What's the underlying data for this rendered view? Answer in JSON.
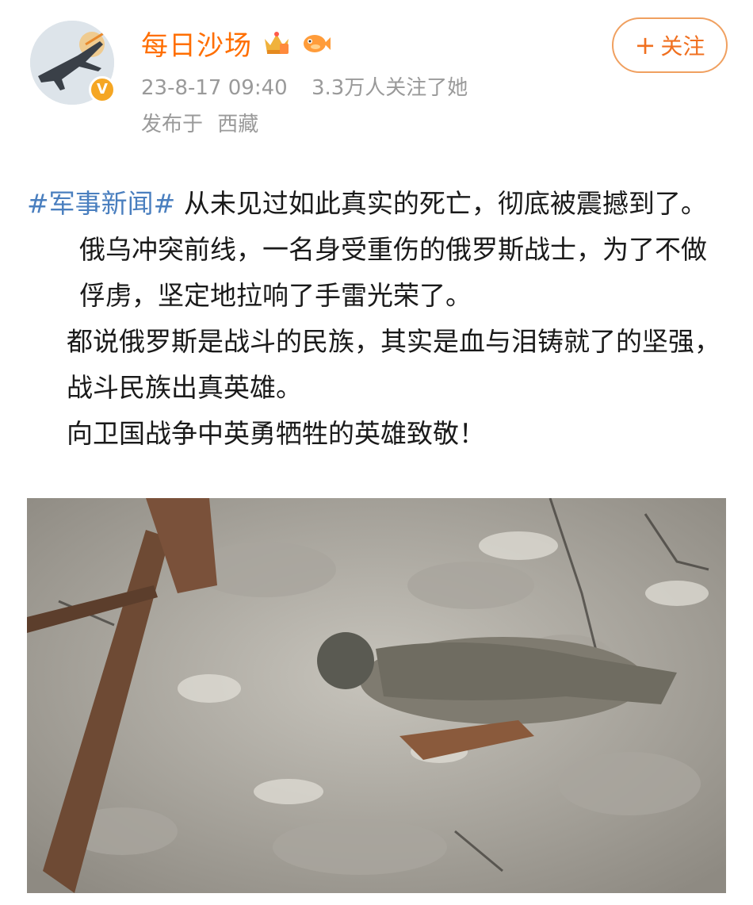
{
  "post": {
    "author": {
      "name": "每日沙场",
      "avatar_icon": "fighter-jet-avatar",
      "verified_icon": "verified-v-icon",
      "badges": [
        "crown-member-icon",
        "fish-badge-icon"
      ]
    },
    "timestamp": "23-8-17 09:40",
    "followers_text": "3.3万人关注了她",
    "location_prefix": "发布于",
    "location": "西藏",
    "follow_button": {
      "icon": "plus-icon",
      "plus": "+",
      "label": "关注"
    },
    "hashtag": "#军事新闻#",
    "paragraphs": [
      "从未见过如此真实的死亡，彻底被震撼到了。",
      "俄乌冲突前线，一名身受重伤的俄罗斯战士，为了不做俘虏，坚定地拉响了手雷光荣了。",
      "都说俄罗斯是战斗的民族，其实是血与泪铸就了的坚强，战斗民族出真英雄。",
      "向卫国战争中英勇牺牲的英雄致敬！"
    ]
  },
  "colors": {
    "username": "#ff6e00",
    "hashtag": "#4a7fbf",
    "meta": "#9a9a9a",
    "follow_border": "#f0a060",
    "verified": "#f5a623"
  }
}
